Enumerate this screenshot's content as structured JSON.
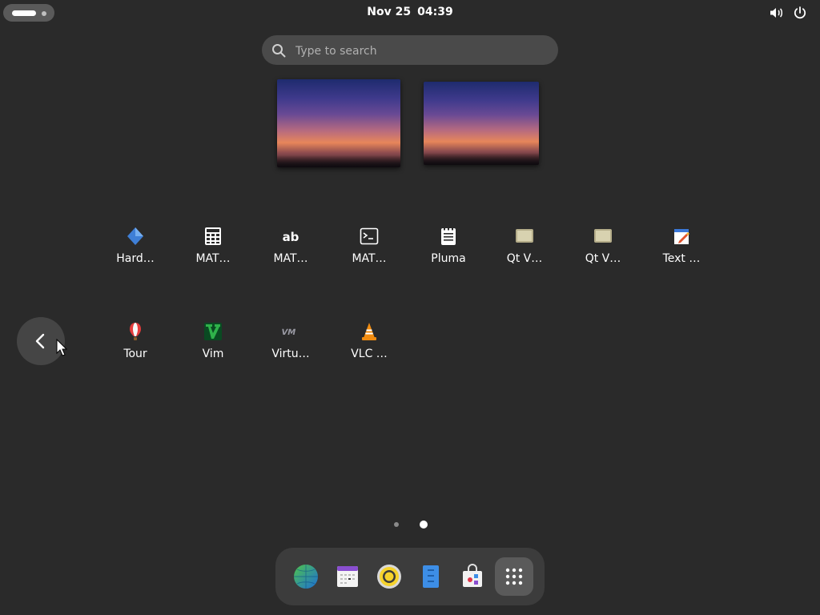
{
  "topbar": {
    "clock_date": "Nov 25",
    "clock_time": "04:39",
    "icons": [
      "activities-indicator",
      "volume-icon",
      "power-icon"
    ]
  },
  "search": {
    "placeholder": "Type to search",
    "value": ""
  },
  "workspaces": [
    "workspace-1-thumbnail",
    "workspace-2-thumbnail"
  ],
  "apps": {
    "row1": [
      {
        "label": "Hard…",
        "icon": "hardinfo-icon"
      },
      {
        "label": "MAT…",
        "icon": "calculator-icon"
      },
      {
        "label": "MAT…",
        "icon": "character-map-icon"
      },
      {
        "label": "MAT…",
        "icon": "terminal-icon"
      },
      {
        "label": "Pluma",
        "icon": "pluma-icon"
      },
      {
        "label": "Qt V…",
        "icon": "qt-app-icon"
      },
      {
        "label": "Qt V…",
        "icon": "qt-app-icon"
      },
      {
        "label": "Text …",
        "icon": "text-editor-icon"
      }
    ],
    "row2": [
      {
        "label": "Tour",
        "icon": "tour-balloon-icon"
      },
      {
        "label": "Vim",
        "icon": "vim-icon"
      },
      {
        "label": "Virtu…",
        "icon": "virtualbox-icon"
      },
      {
        "label": "VLC …",
        "icon": "vlc-icon"
      }
    ]
  },
  "pagination": {
    "pages": 2,
    "current": 2
  },
  "dash": {
    "items": [
      "browser-globe-icon",
      "calendar-icon",
      "rhythmbox-icon",
      "text-document-icon",
      "software-store-icon",
      "show-apps-grid-icon"
    ]
  },
  "colors": {
    "background": "#2a2a2a",
    "search_bg": "#4a4a4a",
    "dash_bg": "#3c3c3c"
  }
}
